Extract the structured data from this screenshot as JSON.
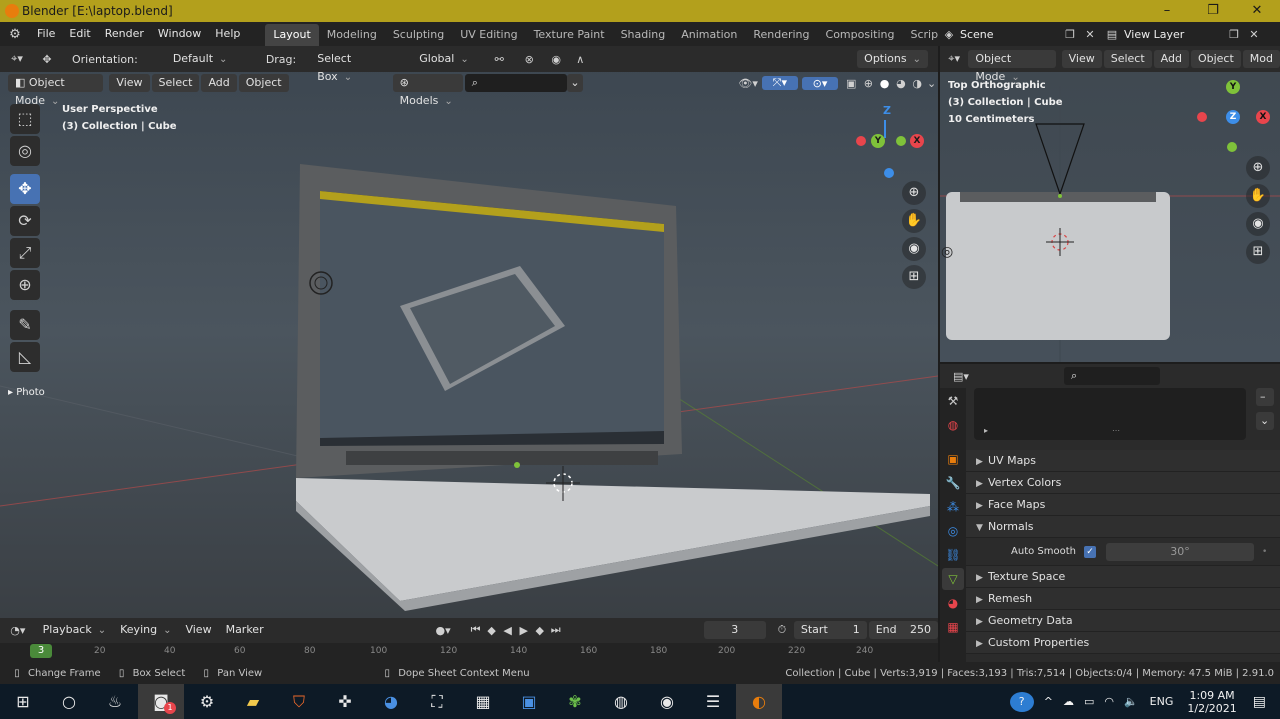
{
  "window": {
    "title": "Blender [E:\\laptop.blend]",
    "minimize": "–",
    "maximize": "❐",
    "close": "✕"
  },
  "menu": {
    "items": [
      "File",
      "Edit",
      "Render",
      "Window",
      "Help"
    ]
  },
  "workspaces": [
    "Layout",
    "Modeling",
    "Sculpting",
    "UV Editing",
    "Texture Paint",
    "Shading",
    "Animation",
    "Rendering",
    "Compositing",
    "Scripting"
  ],
  "workspace_add": "+",
  "scene": {
    "scene_name": "Scene",
    "view_layer": "View Layer"
  },
  "toolheader": {
    "orientation_label": "Orientation:",
    "orientation_value": "Default",
    "drag_label": "Drag:",
    "drag_value": "Select Box",
    "transform_value": "Global",
    "options": "Options"
  },
  "vpheader": {
    "mode": "Object Mode",
    "view": "View",
    "select": "Select",
    "add": "Add",
    "object": "Object",
    "models": "Models"
  },
  "viewport": {
    "perspective": "User Perspective",
    "collection": "(3) Collection | Cube",
    "photo": "Photo"
  },
  "gizmo": {
    "x": "X",
    "y": "Y",
    "z": "Z"
  },
  "rightvp": {
    "mode": "Object Mode",
    "view": "View",
    "select": "Select",
    "add": "Add",
    "object": "Object",
    "more": "Mod",
    "title": "Top Orthographic",
    "collection": "(3) Collection | Cube",
    "scale": "10 Centimeters"
  },
  "properties": {
    "sections": [
      "UV Maps",
      "Vertex Colors",
      "Face Maps",
      "Normals"
    ],
    "auto_smooth_label": "Auto Smooth",
    "auto_smooth_angle": "30°",
    "sections2": [
      "Texture Space",
      "Remesh",
      "Geometry Data",
      "Custom Properties"
    ]
  },
  "timeline": {
    "playback": "Playback",
    "keying": "Keying",
    "view": "View",
    "marker": "Marker",
    "current_frame": "3",
    "start_label": "Start",
    "start": "1",
    "end_label": "End",
    "end": "250",
    "ruler": [
      "0",
      "20",
      "40",
      "60",
      "80",
      "100",
      "120",
      "140",
      "160",
      "180",
      "200",
      "220",
      "240"
    ],
    "cursor_frame": "3"
  },
  "status": {
    "change_frame": "Change Frame",
    "box_select": "Box Select",
    "pan_view": "Pan View",
    "context_menu": "Dope Sheet Context Menu",
    "stats": "Collection | Cube | Verts:3,919 | Faces:3,193 | Tris:7,514 | Objects:0/4 | Memory: 47.5 MiB | 2.91.0"
  },
  "taskbar": {
    "lang": "ENG",
    "time": "1:09 AM",
    "date": "1/2/2021",
    "badge": "1"
  },
  "colors": {
    "accent": "#4772b3",
    "titlebar": "#b3a01c",
    "x_axis": "#e8454c",
    "y_axis": "#7fc23a",
    "z_axis": "#3d8ee8"
  }
}
